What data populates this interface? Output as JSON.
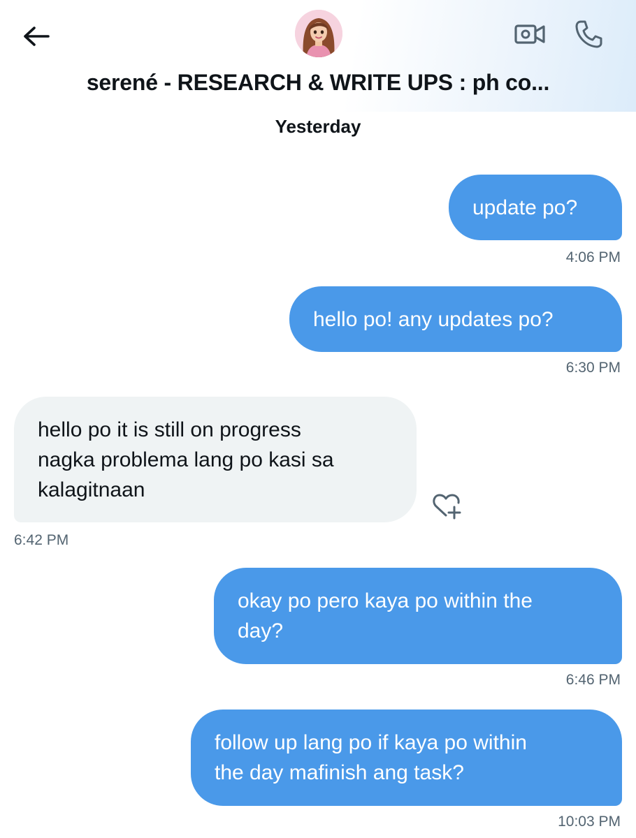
{
  "header": {
    "title": "serené - RESEARCH & WRITE UPS : ph co...",
    "back_icon": "arrow-left-icon",
    "video_icon": "video-call-icon",
    "call_icon": "phone-icon"
  },
  "date_separator": "Yesterday",
  "messages": [
    {
      "direction": "outgoing",
      "text": "update po?",
      "time": "4:06 PM"
    },
    {
      "direction": "outgoing",
      "text": "hello po! any updates po?",
      "time": "6:30 PM"
    },
    {
      "direction": "incoming",
      "lines": [
        "hello po it is still on progress",
        "nagka problema lang po kasi sa",
        "kalagitnaan"
      ],
      "time": "6:42 PM"
    },
    {
      "direction": "outgoing",
      "lines": [
        "okay po pero kaya po within the",
        "day?"
      ],
      "time": "6:46 PM"
    },
    {
      "direction": "outgoing",
      "lines": [
        "follow up lang po if kaya po within",
        "the day mafinish ang task?"
      ],
      "time": "10:03 PM"
    }
  ],
  "colors": {
    "outgoing_bubble": "#4a99e9",
    "incoming_bubble": "#eff3f4",
    "timestamp": "#536471",
    "icon_gray": "#536471"
  }
}
